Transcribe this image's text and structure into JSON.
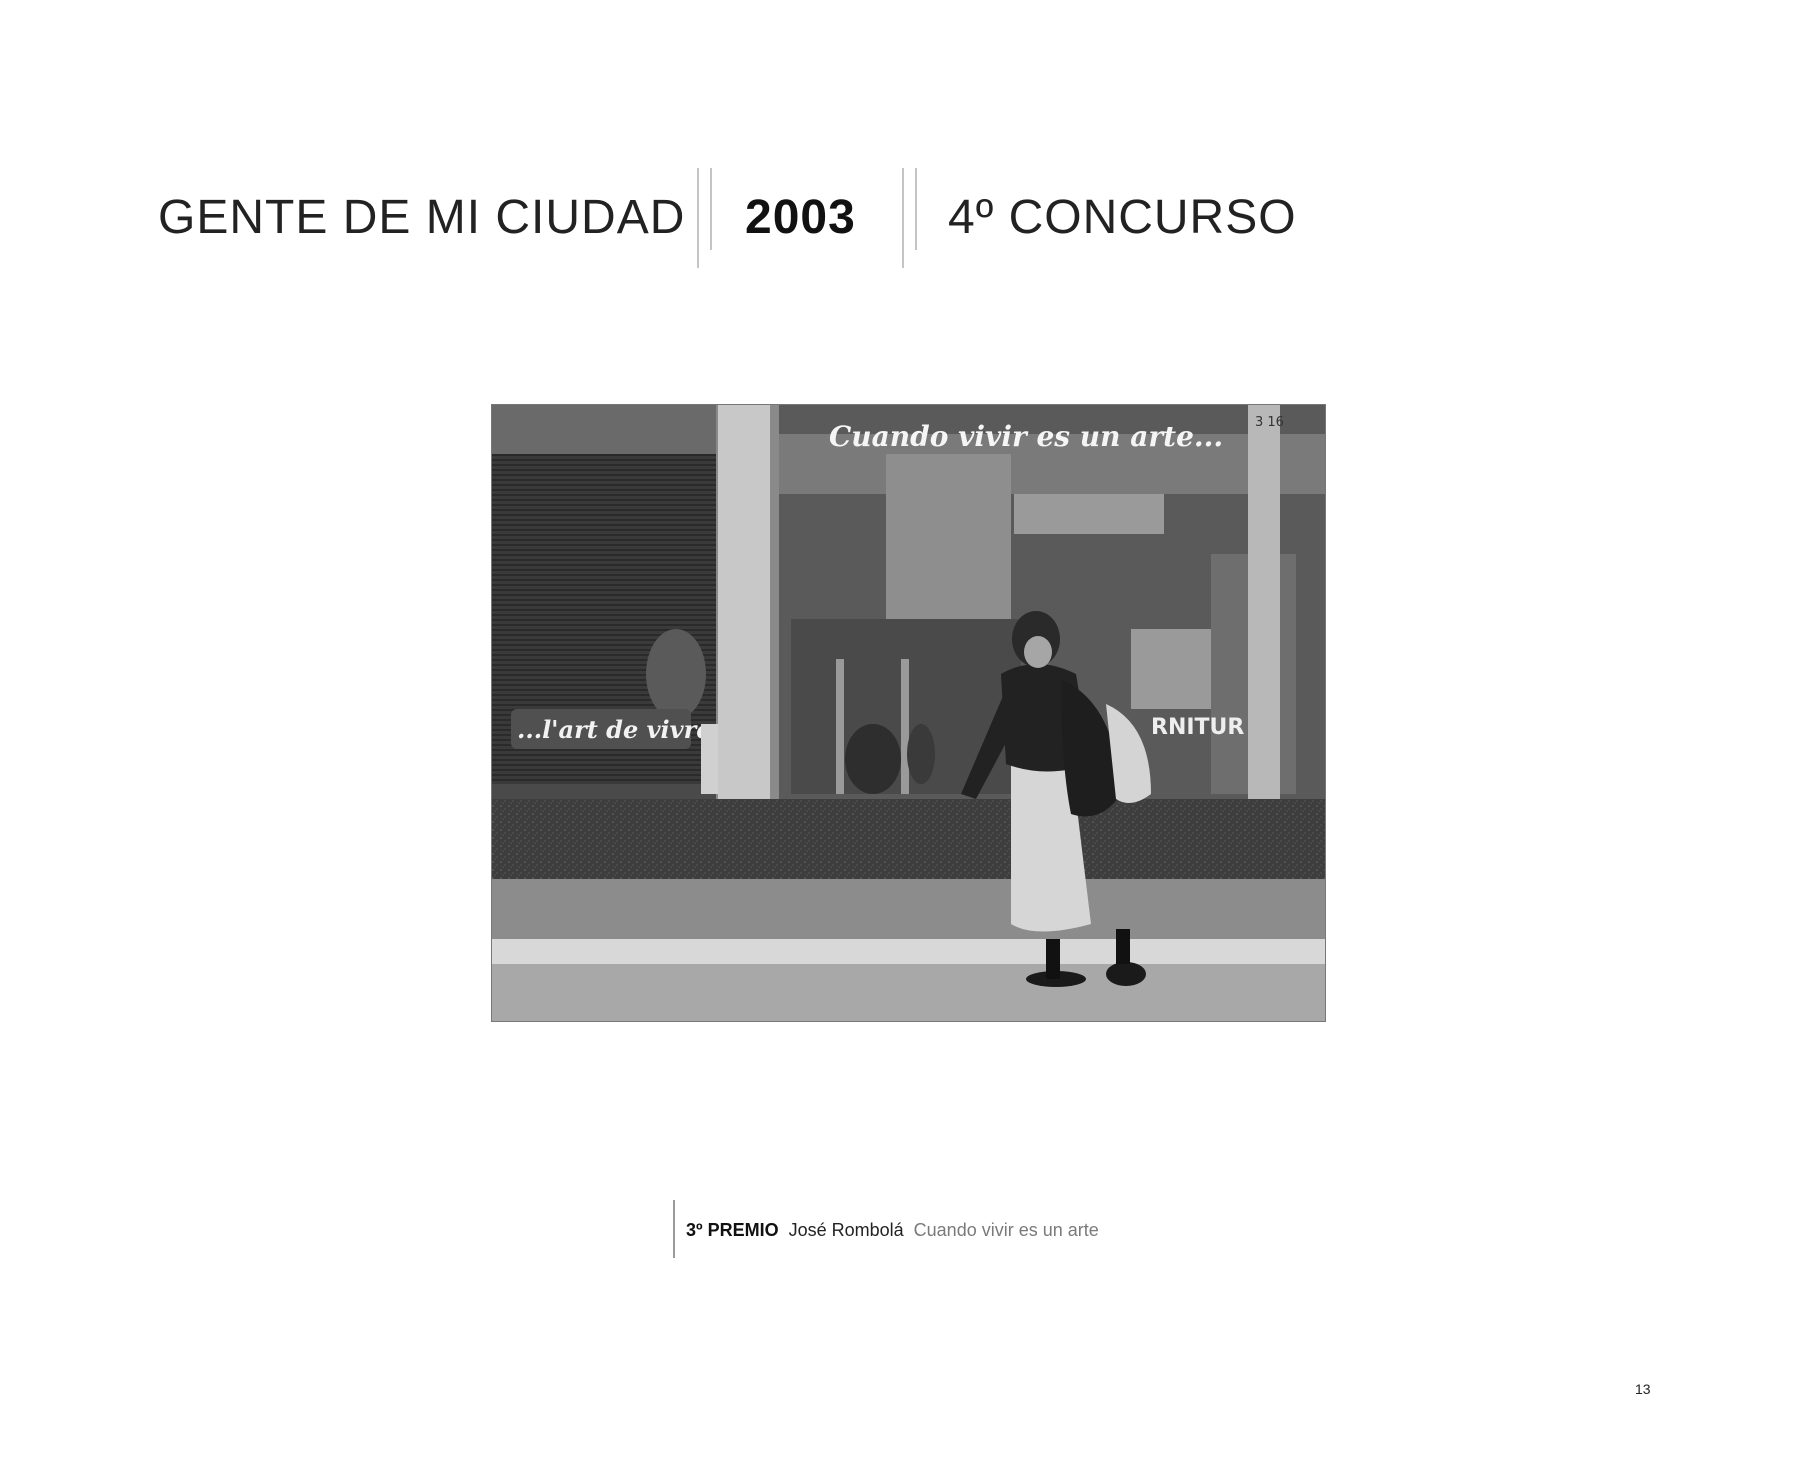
{
  "header": {
    "title": "GENTE DE MI CIUDAD",
    "year": "2003",
    "contest": "4º CONCURSO"
  },
  "photo": {
    "sign_top": "Cuando vivir es un arte...",
    "sign_left": "...l'art de vivre",
    "sign_right": "RNITUR",
    "pole_number": "3 16"
  },
  "caption": {
    "prize": "3º PREMIO",
    "author": "José Rombolá",
    "work_title": "Cuando vivir es un arte"
  },
  "page_number": "13"
}
